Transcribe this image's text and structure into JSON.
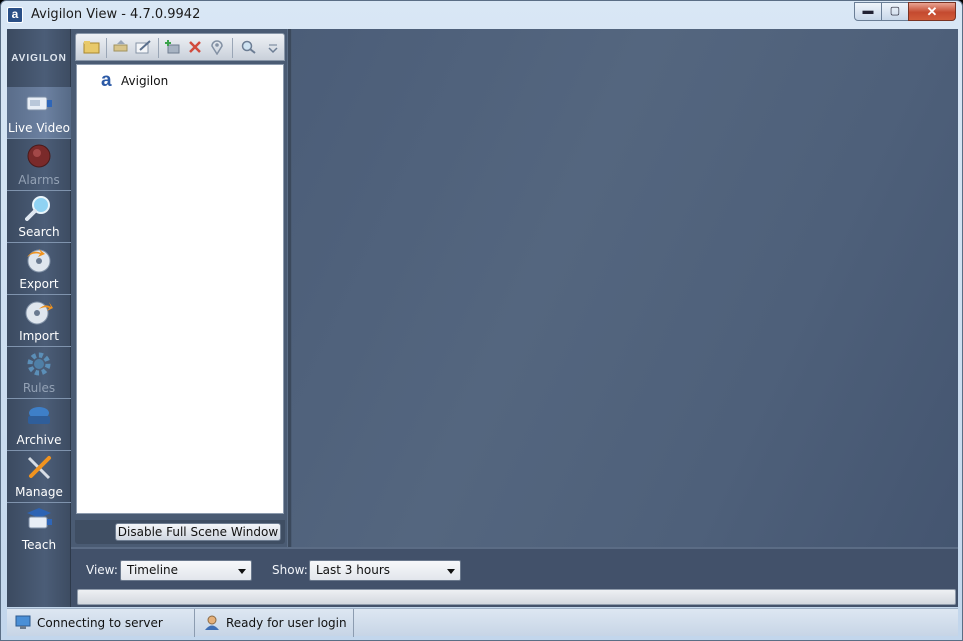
{
  "window": {
    "title": "Avigilon View - 4.7.0.9942",
    "app_icon": "a",
    "minimize_glyph": "▬",
    "maximize_glyph": "▢",
    "close_glyph": "✕"
  },
  "nav": {
    "logo": "AVIGILON",
    "items": [
      {
        "label": "Live Video",
        "icon": "camera-icon",
        "enabled": true,
        "active": true
      },
      {
        "label": "Alarms",
        "icon": "alarm-light-icon",
        "enabled": false
      },
      {
        "label": "Search",
        "icon": "magnifier-icon",
        "enabled": true
      },
      {
        "label": "Export",
        "icon": "disc-export-icon",
        "enabled": true
      },
      {
        "label": "Import",
        "icon": "disc-import-icon",
        "enabled": true
      },
      {
        "label": "Rules",
        "icon": "gear-icon",
        "enabled": false
      },
      {
        "label": "Archive",
        "icon": "archive-drive-icon",
        "enabled": true
      },
      {
        "label": "Manage",
        "icon": "wrench-screwdriver-icon",
        "enabled": true
      },
      {
        "label": "Teach",
        "icon": "graduation-camera-icon",
        "enabled": true
      }
    ]
  },
  "toolbar": {
    "icons": [
      "new-folder-icon",
      "move-icon",
      "edit-icon",
      "add-camera-icon",
      "delete-icon",
      "location-pin-icon",
      "find-icon",
      "overflow-icon"
    ]
  },
  "tree": {
    "root_icon": "a",
    "root_label": "Avigilon"
  },
  "panel": {
    "disable_full_scene_label": "Disable Full Scene Window"
  },
  "controls": {
    "view_label": "View:",
    "view_value": "Timeline",
    "show_label": "Show:",
    "show_value": "Last 3 hours"
  },
  "status": {
    "connection": "Connecting to server",
    "user": "Ready for user login"
  },
  "colors": {
    "main_bg": "#4f617b",
    "nav_bg": "#45566f",
    "accent_blue": "#2c5aa6",
    "close_red": "#c44a2f"
  }
}
